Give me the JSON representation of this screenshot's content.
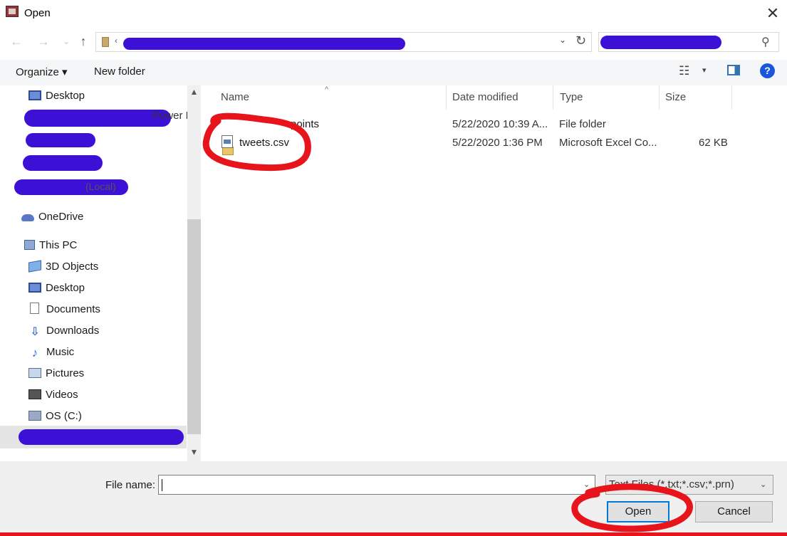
{
  "window": {
    "title": "Open",
    "close_glyph": "✕"
  },
  "nav_buttons": {
    "back": "←",
    "forward": "→",
    "recent": "⌄",
    "up": "↑"
  },
  "address": {
    "chevron": "‹",
    "dropdown_glyph": "⌄",
    "refresh_glyph": "↻"
  },
  "search": {
    "icon": "search-icon",
    "glyph": "⚲"
  },
  "toolbar": {
    "organize_label": "Organize ▾",
    "new_folder_label": "New folder",
    "view_glyph": "☷",
    "view_caret": "▾",
    "help_glyph": "?"
  },
  "nav_pane": {
    "items": [
      {
        "label": "Desktop",
        "icon": "desktop-icon"
      },
      {
        "label": "OneDrive",
        "icon": "onedrive-icon"
      },
      {
        "label": "This PC",
        "icon": "this-pc-icon"
      },
      {
        "label": "3D Objects",
        "icon": "3d-objects-icon"
      },
      {
        "label": "Desktop",
        "icon": "desktop-icon"
      },
      {
        "label": "Documents",
        "icon": "documents-icon"
      },
      {
        "label": "Downloads",
        "icon": "downloads-icon"
      },
      {
        "label": "Music",
        "icon": "music-icon"
      },
      {
        "label": "Pictures",
        "icon": "pictures-icon"
      },
      {
        "label": "Videos",
        "icon": "videos-icon"
      },
      {
        "label": "OS (C:)",
        "icon": "drive-icon"
      }
    ],
    "partial_texts": [
      "Power BI",
      "(Local)"
    ],
    "scroll_up": "▲",
    "scroll_down": "▼"
  },
  "file_list": {
    "columns": [
      "Name",
      "Date modified",
      "Type",
      "Size"
    ],
    "sort_caret": "^",
    "rows": [
      {
        "name": "points",
        "date": "5/22/2020 10:39 A...",
        "type": "File folder",
        "size": ""
      },
      {
        "name": "tweets.csv",
        "date": "5/22/2020 1:36 PM",
        "type": "Microsoft Excel Co...",
        "size": "62 KB"
      }
    ]
  },
  "bottom": {
    "file_name_label": "File name:",
    "file_name_value": "",
    "dropdown_glyph": "⌄",
    "file_type": "Text Files (*.txt;*.csv;*.prn)",
    "open_label": "Open",
    "cancel_label": "Cancel"
  },
  "colors": {
    "redaction": "#3d10d6",
    "annotation": "#e8141c",
    "accent": "#0078d7"
  }
}
